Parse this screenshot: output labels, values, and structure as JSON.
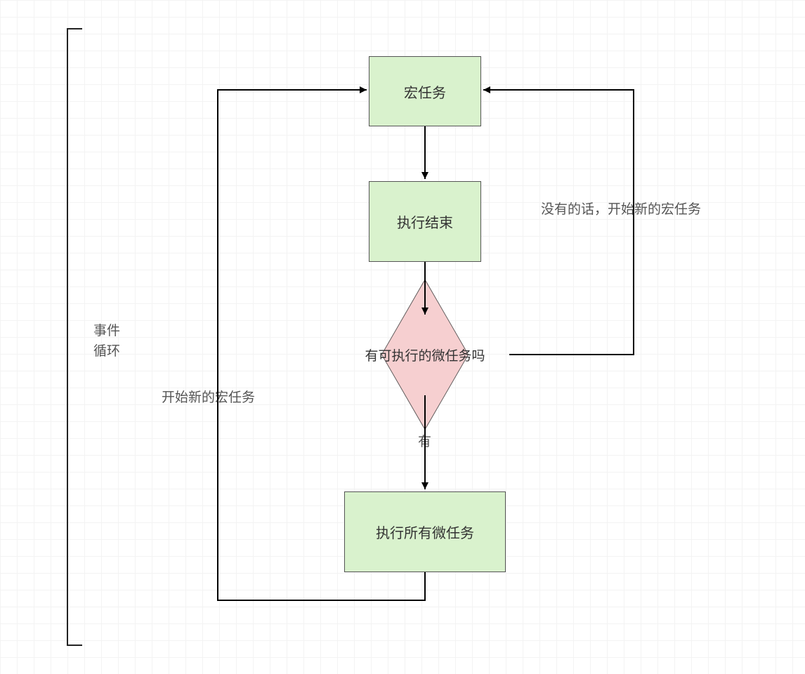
{
  "bracket_label_line1": "事件",
  "bracket_label_line2": "循环",
  "nodes": {
    "macro_task": "宏任务",
    "exec_end": "执行结束",
    "has_micro": "有可执行的微任务吗",
    "exec_all_micro": "执行所有微任务"
  },
  "edge_labels": {
    "yes": "有",
    "no_new_macro": "没有的话，开始新的宏任务",
    "start_new_macro": "开始新的宏任务"
  }
}
